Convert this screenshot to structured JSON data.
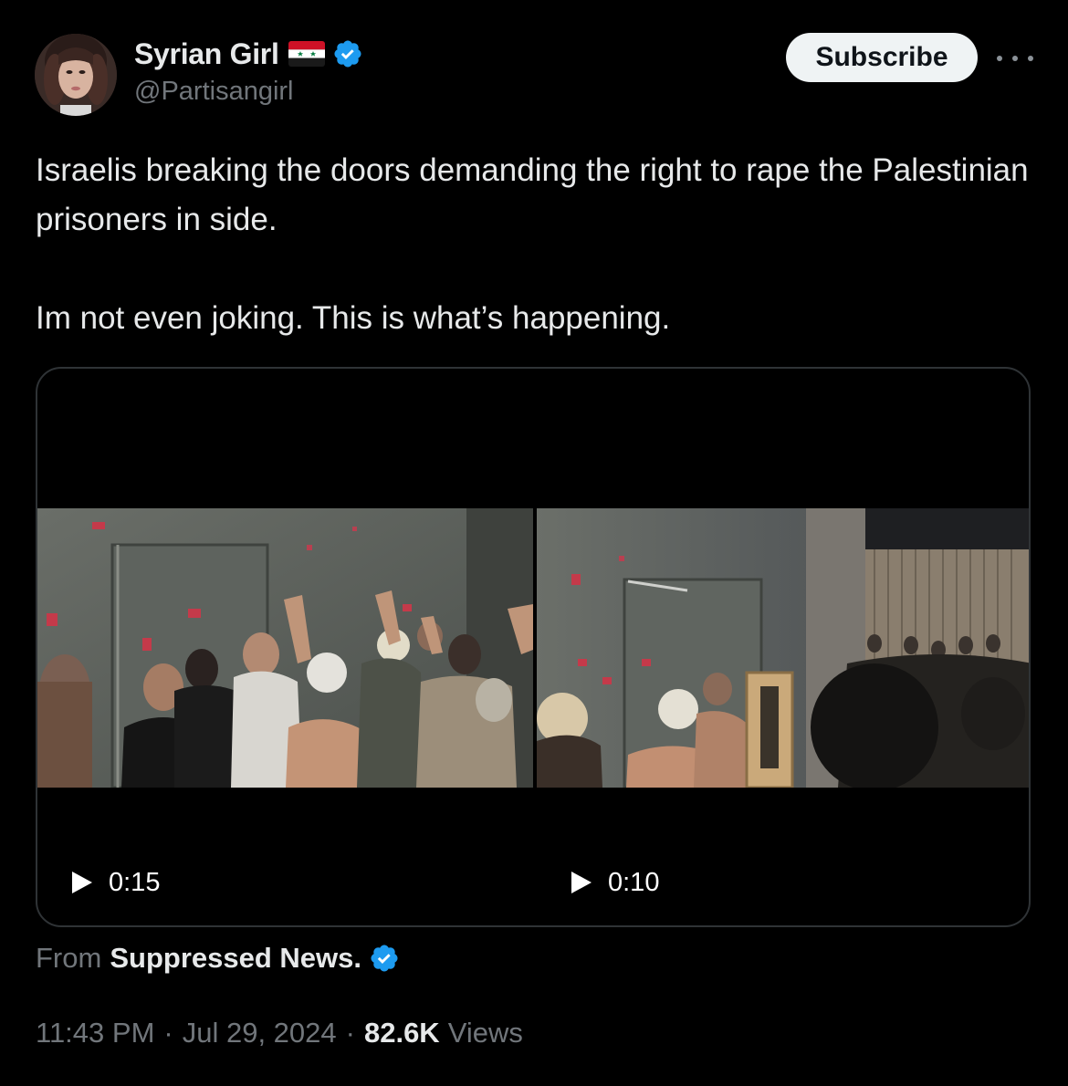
{
  "author": {
    "display_name": "Syrian Girl",
    "handle": "@Partisangirl",
    "flag_icon": "syria-flag-icon",
    "verified_icon": "verified-badge-icon",
    "avatar_icon": "profile-avatar"
  },
  "header": {
    "subscribe_label": "Subscribe",
    "more_icon": "more-options-icon"
  },
  "tweet": {
    "paragraphs": [
      "Israelis breaking the doors demanding the right to rape the Palestinian prisoners in side.",
      "Im not even joking. This is what’s happening."
    ]
  },
  "media": {
    "videos": [
      {
        "duration": "0:15",
        "play_icon": "play-icon"
      },
      {
        "duration": "0:10",
        "play_icon": "play-icon"
      }
    ]
  },
  "attribution": {
    "prefix": "From",
    "source": "Suppressed News.",
    "verified_icon": "verified-badge-icon"
  },
  "meta": {
    "time": "11:43 PM",
    "separator": "·",
    "date": "Jul 29, 2024",
    "views_count": "82.6K",
    "views_label": "Views"
  },
  "colors": {
    "background": "#000000",
    "text_primary": "#e7e9ea",
    "text_secondary": "#71767b",
    "verified_blue": "#1d9bf0",
    "border": "#2f3336"
  }
}
